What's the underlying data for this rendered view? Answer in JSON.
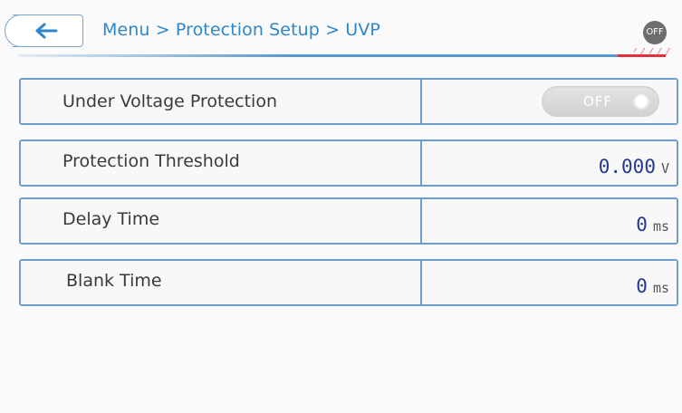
{
  "header": {
    "breadcrumb": "Menu > Protection Setup > UVP",
    "status_badge": "OFF"
  },
  "rows": [
    {
      "label": "Under Voltage Protection",
      "toggle_state": "OFF"
    },
    {
      "label": "Protection Threshold",
      "value": "0.000",
      "unit": "V"
    },
    {
      "label": "Delay Time",
      "value": "0",
      "unit": "ms"
    },
    {
      "label": "Blank Time",
      "value": "0",
      "unit": "ms"
    }
  ],
  "icons": {
    "back": "arrow-left-icon"
  },
  "colors": {
    "accent": "#2f86c8",
    "border": "#6c9dcc",
    "value_text": "#253a8c",
    "status_off": "#6d6d6d",
    "warning_red": "#e0303a"
  }
}
